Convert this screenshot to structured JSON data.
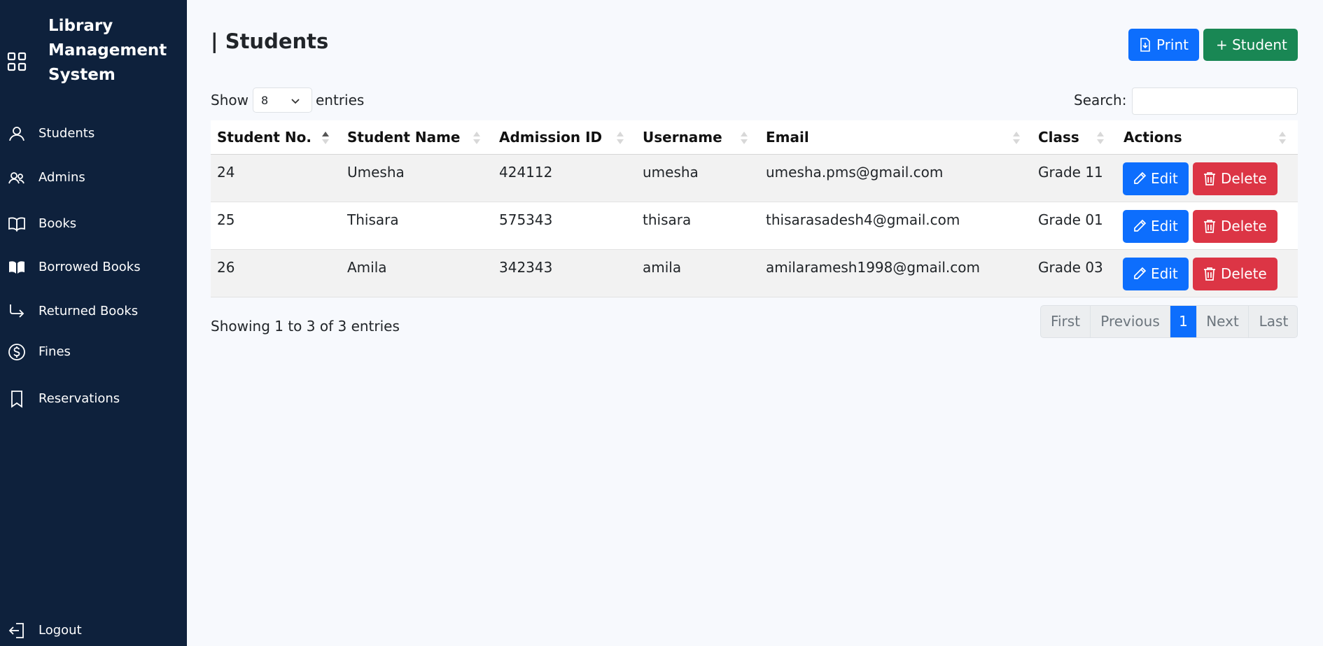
{
  "app": {
    "title": "Library Management System",
    "title_lines": [
      "Library",
      "Management",
      "System"
    ]
  },
  "sidebar": {
    "items": [
      {
        "label": "Students",
        "icon": "person-icon"
      },
      {
        "label": "Admins",
        "icon": "people-icon"
      },
      {
        "label": "Books",
        "icon": "book-icon"
      },
      {
        "label": "Borrowed Books",
        "icon": "book-open-icon"
      },
      {
        "label": "Returned Books",
        "icon": "return-arrow-icon"
      },
      {
        "label": "Fines",
        "icon": "dollar-circle-icon"
      },
      {
        "label": "Reservations",
        "icon": "bookmark-icon"
      }
    ],
    "logout": {
      "label": "Logout",
      "icon": "logout-icon"
    }
  },
  "header": {
    "title": "| Students",
    "print_label": "Print",
    "add_student_label": "+ Student"
  },
  "controls": {
    "show_label": "Show",
    "entries_value": "8",
    "entries_label": "entries",
    "search_label": "Search:",
    "search_value": ""
  },
  "table": {
    "columns": [
      "Student No.",
      "Student Name",
      "Admission ID",
      "Username",
      "Email",
      "Class",
      "Actions"
    ],
    "rows": [
      {
        "student_no": "24",
        "name": "Umesha",
        "admission_id": "424112",
        "username": "umesha",
        "email": "umesha.pms@gmail.com",
        "class": "Grade 11"
      },
      {
        "student_no": "25",
        "name": "Thisara",
        "admission_id": "575343",
        "username": "thisara",
        "email": "thisarasadesh4@gmail.com",
        "class": "Grade 01"
      },
      {
        "student_no": "26",
        "name": "Amila",
        "admission_id": "342343",
        "username": "amila",
        "email": "amilaramesh1998@gmail.com",
        "class": "Grade 03"
      }
    ],
    "edit_label": "Edit",
    "delete_label": "Delete"
  },
  "footer": {
    "info": "Showing 1 to 3 of 3 entries",
    "pagination": {
      "first": "First",
      "previous": "Previous",
      "current": "1",
      "next": "Next",
      "last": "Last"
    }
  },
  "colors": {
    "sidebar_bg": "#0e213c",
    "primary": "#0d6efd",
    "success": "#198754",
    "danger": "#dc3545"
  }
}
